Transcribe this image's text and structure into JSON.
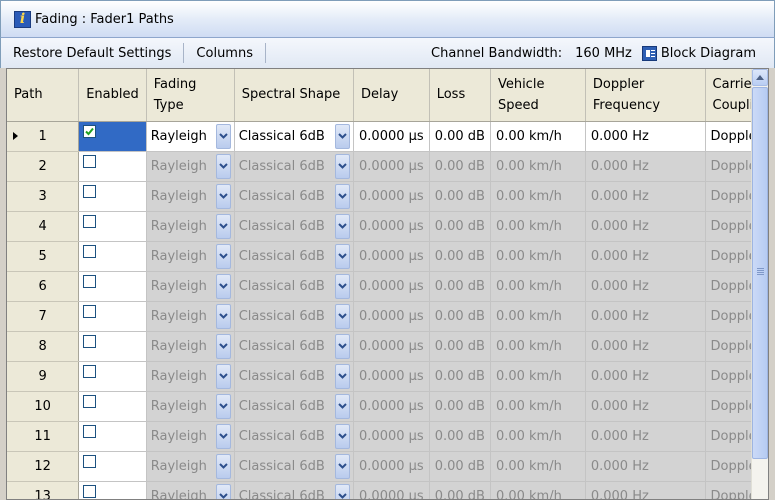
{
  "window": {
    "title": "Fading : Fader1 Paths"
  },
  "toolbar": {
    "restore_label": "Restore Default Settings",
    "columns_label": "Columns",
    "bandwidth_label": "Channel Bandwidth:",
    "bandwidth_value": "160 MHz",
    "block_diagram_label": "Block Diagram"
  },
  "table": {
    "headers": {
      "path": "Path",
      "enabled": "Enabled",
      "fading_type_1": "Fading",
      "fading_type_2": "Type",
      "spectral_shape": "Spectral Shape",
      "delay": "Delay",
      "loss": "Loss",
      "vehicle_speed_1": "Vehicle",
      "vehicle_speed_2": "Speed",
      "doppler_frequency_1": "Doppler",
      "doppler_frequency_2": "Frequency",
      "carrier_coupling_1": "Carrier",
      "carrier_coupling_2": "Coupli"
    },
    "rows": [
      {
        "path": "1",
        "enabled": true,
        "fading_type": "Rayleigh",
        "spectral_shape": "Classical 6dB",
        "delay": "0.0000 µs",
        "loss": "0.00 dB",
        "vehicle_speed": "0.00 km/h",
        "doppler_frequency": "0.000 Hz",
        "carrier_coupling": "Doppler"
      },
      {
        "path": "2",
        "enabled": false,
        "fading_type": "Rayleigh",
        "spectral_shape": "Classical 6dB",
        "delay": "0.0000 µs",
        "loss": "0.00 dB",
        "vehicle_speed": "0.00 km/h",
        "doppler_frequency": "0.000 Hz",
        "carrier_coupling": "Doppler"
      },
      {
        "path": "3",
        "enabled": false,
        "fading_type": "Rayleigh",
        "spectral_shape": "Classical 6dB",
        "delay": "0.0000 µs",
        "loss": "0.00 dB",
        "vehicle_speed": "0.00 km/h",
        "doppler_frequency": "0.000 Hz",
        "carrier_coupling": "Doppler"
      },
      {
        "path": "4",
        "enabled": false,
        "fading_type": "Rayleigh",
        "spectral_shape": "Classical 6dB",
        "delay": "0.0000 µs",
        "loss": "0.00 dB",
        "vehicle_speed": "0.00 km/h",
        "doppler_frequency": "0.000 Hz",
        "carrier_coupling": "Doppler"
      },
      {
        "path": "5",
        "enabled": false,
        "fading_type": "Rayleigh",
        "spectral_shape": "Classical 6dB",
        "delay": "0.0000 µs",
        "loss": "0.00 dB",
        "vehicle_speed": "0.00 km/h",
        "doppler_frequency": "0.000 Hz",
        "carrier_coupling": "Doppler"
      },
      {
        "path": "6",
        "enabled": false,
        "fading_type": "Rayleigh",
        "spectral_shape": "Classical 6dB",
        "delay": "0.0000 µs",
        "loss": "0.00 dB",
        "vehicle_speed": "0.00 km/h",
        "doppler_frequency": "0.000 Hz",
        "carrier_coupling": "Doppler"
      },
      {
        "path": "7",
        "enabled": false,
        "fading_type": "Rayleigh",
        "spectral_shape": "Classical 6dB",
        "delay": "0.0000 µs",
        "loss": "0.00 dB",
        "vehicle_speed": "0.00 km/h",
        "doppler_frequency": "0.000 Hz",
        "carrier_coupling": "Doppler"
      },
      {
        "path": "8",
        "enabled": false,
        "fading_type": "Rayleigh",
        "spectral_shape": "Classical 6dB",
        "delay": "0.0000 µs",
        "loss": "0.00 dB",
        "vehicle_speed": "0.00 km/h",
        "doppler_frequency": "0.000 Hz",
        "carrier_coupling": "Doppler"
      },
      {
        "path": "9",
        "enabled": false,
        "fading_type": "Rayleigh",
        "spectral_shape": "Classical 6dB",
        "delay": "0.0000 µs",
        "loss": "0.00 dB",
        "vehicle_speed": "0.00 km/h",
        "doppler_frequency": "0.000 Hz",
        "carrier_coupling": "Doppler"
      },
      {
        "path": "10",
        "enabled": false,
        "fading_type": "Rayleigh",
        "spectral_shape": "Classical 6dB",
        "delay": "0.0000 µs",
        "loss": "0.00 dB",
        "vehicle_speed": "0.00 km/h",
        "doppler_frequency": "0.000 Hz",
        "carrier_coupling": "Doppler"
      },
      {
        "path": "11",
        "enabled": false,
        "fading_type": "Rayleigh",
        "spectral_shape": "Classical 6dB",
        "delay": "0.0000 µs",
        "loss": "0.00 dB",
        "vehicle_speed": "0.00 km/h",
        "doppler_frequency": "0.000 Hz",
        "carrier_coupling": "Doppler"
      },
      {
        "path": "12",
        "enabled": false,
        "fading_type": "Rayleigh",
        "spectral_shape": "Classical 6dB",
        "delay": "0.0000 µs",
        "loss": "0.00 dB",
        "vehicle_speed": "0.00 km/h",
        "doppler_frequency": "0.000 Hz",
        "carrier_coupling": "Doppler"
      },
      {
        "path": "13",
        "enabled": false,
        "fading_type": "Rayleigh",
        "spectral_shape": "Classical 6dB",
        "delay": "0.0000 µs",
        "loss": "0.00 dB",
        "vehicle_speed": "0.00 km/h",
        "doppler_frequency": "0.000 Hz",
        "carrier_coupling": "Doppler"
      }
    ]
  },
  "icons": {
    "title": "info-icon",
    "block_diagram": "block-diagram-icon",
    "dropdown": "chevron-down-icon",
    "checkbox_checked": "checkmark-icon",
    "row_pointer": "row-pointer-icon",
    "scroll_up": "arrow-up-icon"
  },
  "colors": {
    "selection": "#316ac5",
    "disabled_text": "#8a8a8a",
    "disabled_bg": "#d3d3d3",
    "header_bg": "#ece9d8"
  }
}
